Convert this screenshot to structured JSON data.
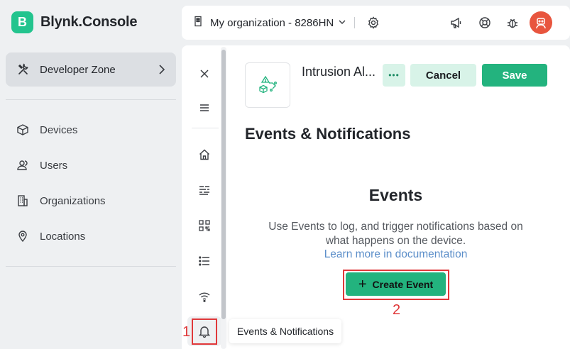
{
  "brand": {
    "logo_letter": "B",
    "name": "Blynk.Console",
    "color": "#23c48e"
  },
  "sidebar": {
    "developer_zone": {
      "label": "Developer Zone",
      "icon": "tools-icon"
    },
    "items": [
      {
        "label": "Devices",
        "icon": "cube-icon"
      },
      {
        "label": "Users",
        "icon": "users-icon"
      },
      {
        "label": "Organizations",
        "icon": "building-icon"
      },
      {
        "label": "Locations",
        "icon": "location-pin-icon"
      }
    ]
  },
  "topbar": {
    "organization": "My organization - 8286HN",
    "icons": [
      "settings-gear-icon",
      "announcement-megaphone-icon",
      "help-lifebuoy-icon",
      "bug-icon",
      "user-avatar"
    ]
  },
  "rail": {
    "icons": [
      "close-icon",
      "menu-icon",
      "home-icon",
      "datastreams-icon",
      "qr-icon",
      "list-icon",
      "wifi-icon",
      "bell-icon"
    ]
  },
  "product": {
    "name": "Intrusion Al...",
    "more_label": "•••",
    "cancel_label": "Cancel",
    "save_label": "Save"
  },
  "page": {
    "title": "Events & Notifications",
    "events_heading": "Events",
    "description": "Use Events to log, and trigger notifications based on what happens on the device.",
    "link": "Learn more in documentation",
    "create_button": "Create Event",
    "create_plus": "+"
  },
  "tooltip": "Events & Notifications",
  "annotations": {
    "step1": "1",
    "step2": "2",
    "color": "#e0383a"
  }
}
